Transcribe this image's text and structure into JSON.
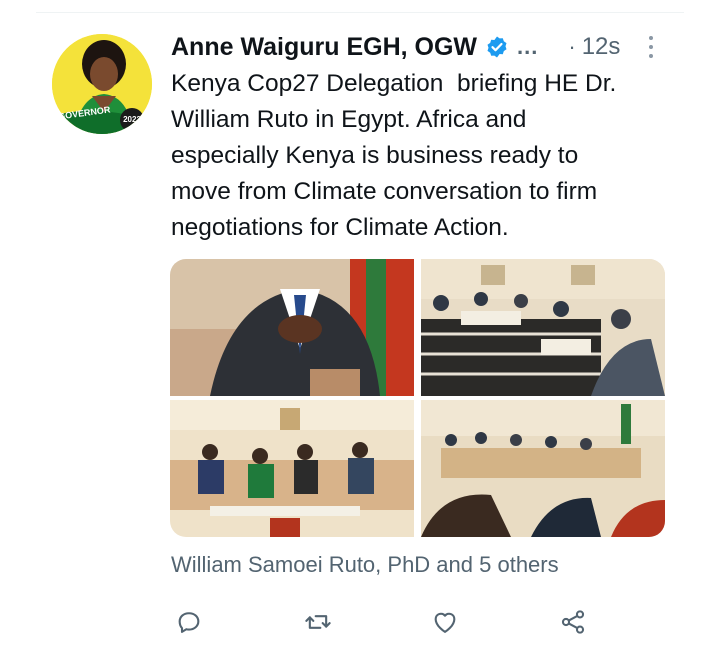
{
  "tweet": {
    "author_name": "Anne Waiguru EGH, OGW",
    "ellipsis": "...",
    "separator": "·",
    "timestamp": "12s",
    "text": "Kenya Cop27 Delegation  briefing HE Dr.\nWilliam Ruto in Egypt. Africa and\nespecially Kenya is business ready to\nmove from Climate conversation to firm\nnegotiations for Climate Action.",
    "avatar": {
      "badge_left": "GOVERNOR",
      "badge_right": "2022",
      "brand_color": "#f6e63a"
    },
    "likes_text": "William Samoei Ruto, PhD and 5 others"
  },
  "icons": {
    "verified": "verified-badge-icon",
    "more": "more-options-icon",
    "reply": "reply-icon",
    "retweet": "retweet-icon",
    "like": "like-icon",
    "share": "share-icon"
  },
  "colors": {
    "verified_blue": "#1d9bf0",
    "muted": "#536471",
    "text": "#0f1419"
  }
}
